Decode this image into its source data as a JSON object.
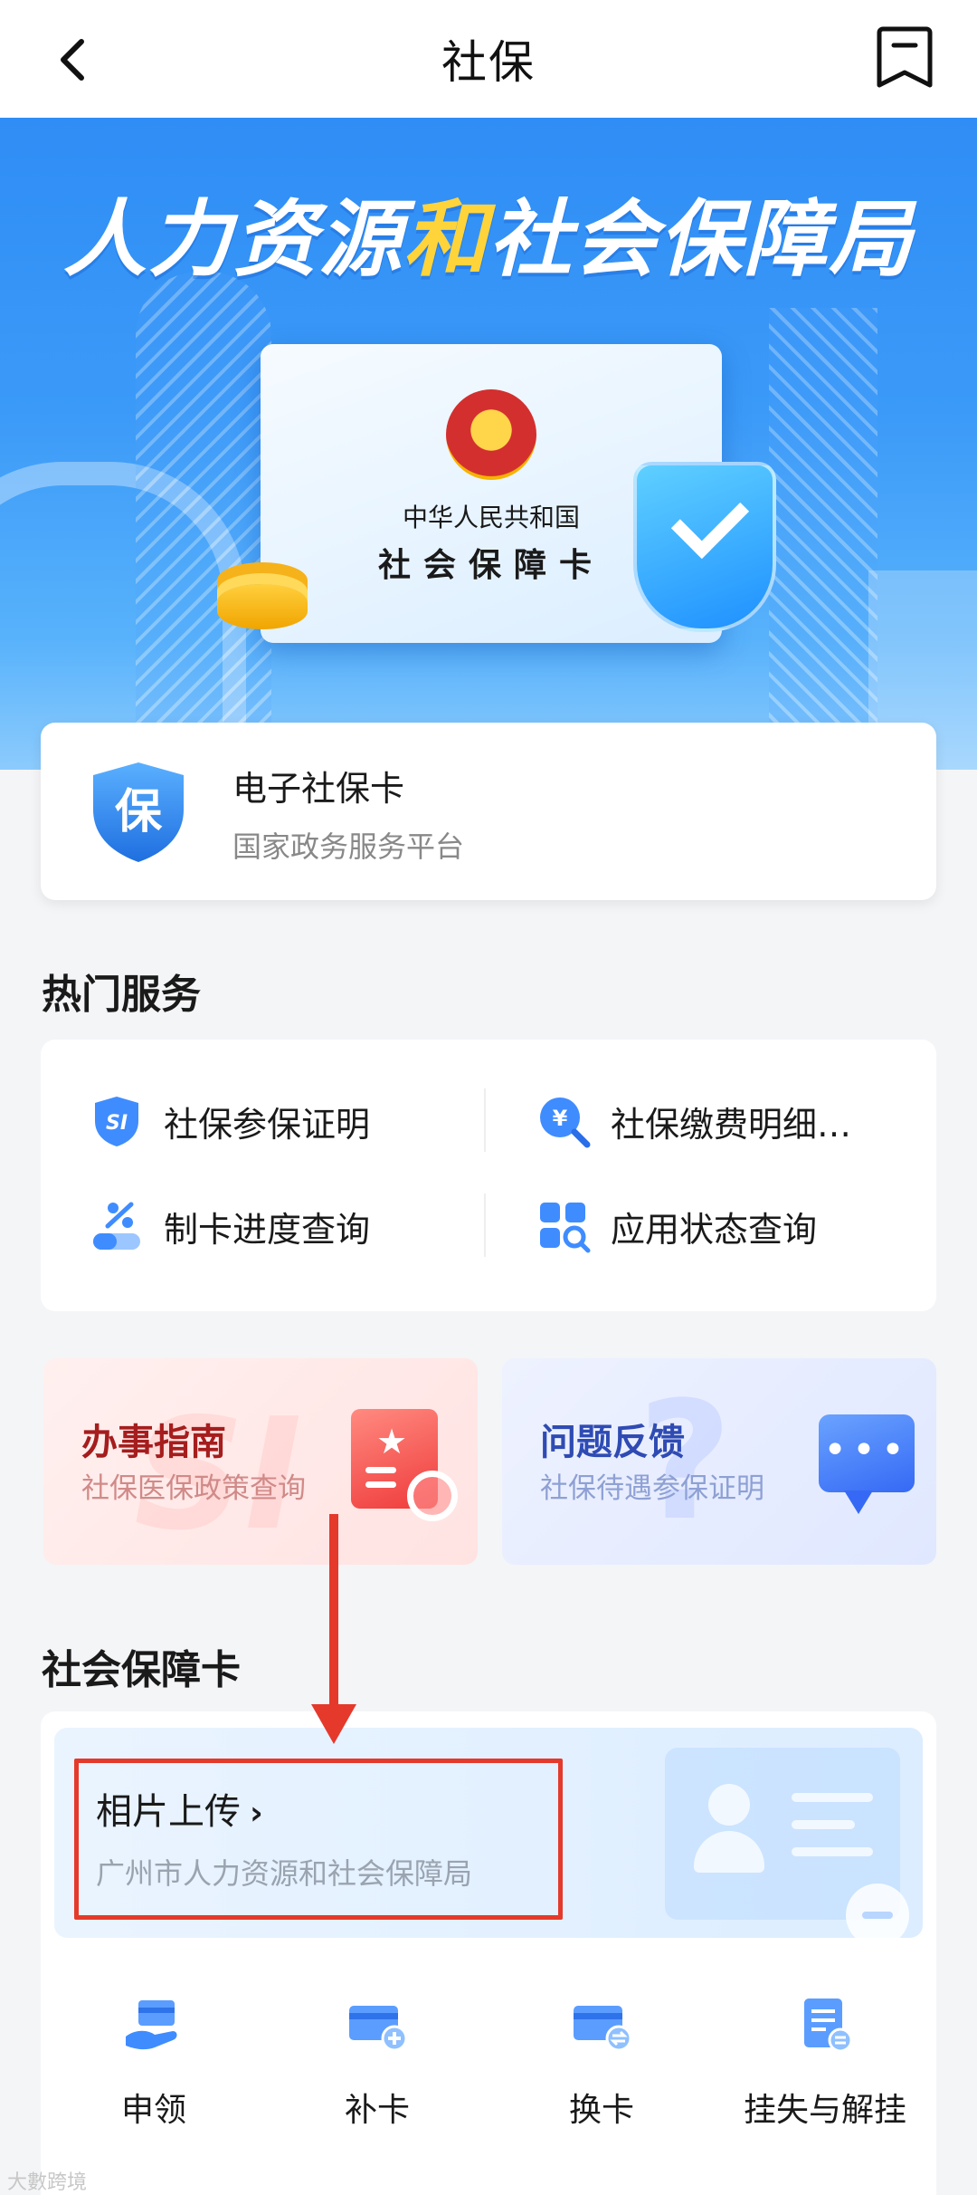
{
  "header": {
    "title": "社保"
  },
  "banner": {
    "title_part1": "人力资源",
    "title_highlight": "和",
    "title_part2": "社会保障局",
    "card_line1": "中华人民共和国",
    "card_line2": "社会保障卡"
  },
  "ecard": {
    "icon_char": "保",
    "title": "电子社保卡",
    "subtitle": "国家政务服务平台"
  },
  "hot_services": {
    "section_title": "热门服务",
    "items": [
      {
        "label": "社保参保证明",
        "icon": "si-shield-icon"
      },
      {
        "label": "社保缴费明细…",
        "icon": "yuan-search-icon"
      },
      {
        "label": "制卡进度查询",
        "icon": "card-progress-icon"
      },
      {
        "label": "应用状态查询",
        "icon": "app-status-icon"
      }
    ]
  },
  "promos": [
    {
      "title": "办事指南",
      "subtitle": "社保医保政策查询",
      "icon": "guide-doc-icon",
      "accent": "#a51d1d"
    },
    {
      "title": "问题反馈",
      "subtitle": "社保待遇参保证明",
      "icon": "chat-bubble-icon",
      "accent": "#2f4bb3"
    }
  ],
  "ss_card": {
    "section_title": "社会保障卡",
    "photo_upload": {
      "title": "相片上传",
      "chevron": "›",
      "subtitle": "广州市人力资源和社会保障局"
    },
    "actions": [
      {
        "label": "申领",
        "icon": "apply-card-icon"
      },
      {
        "label": "补卡",
        "icon": "card-reissue-icon"
      },
      {
        "label": "换卡",
        "icon": "card-exchange-icon"
      },
      {
        "label": "挂失与解挂",
        "icon": "report-loss-icon"
      }
    ]
  },
  "watermark": "大數跨境",
  "colors": {
    "banner_blue": "#2f8df5",
    "highlight_yellow": "#ffd43b",
    "annotation_red": "#e5392b"
  }
}
